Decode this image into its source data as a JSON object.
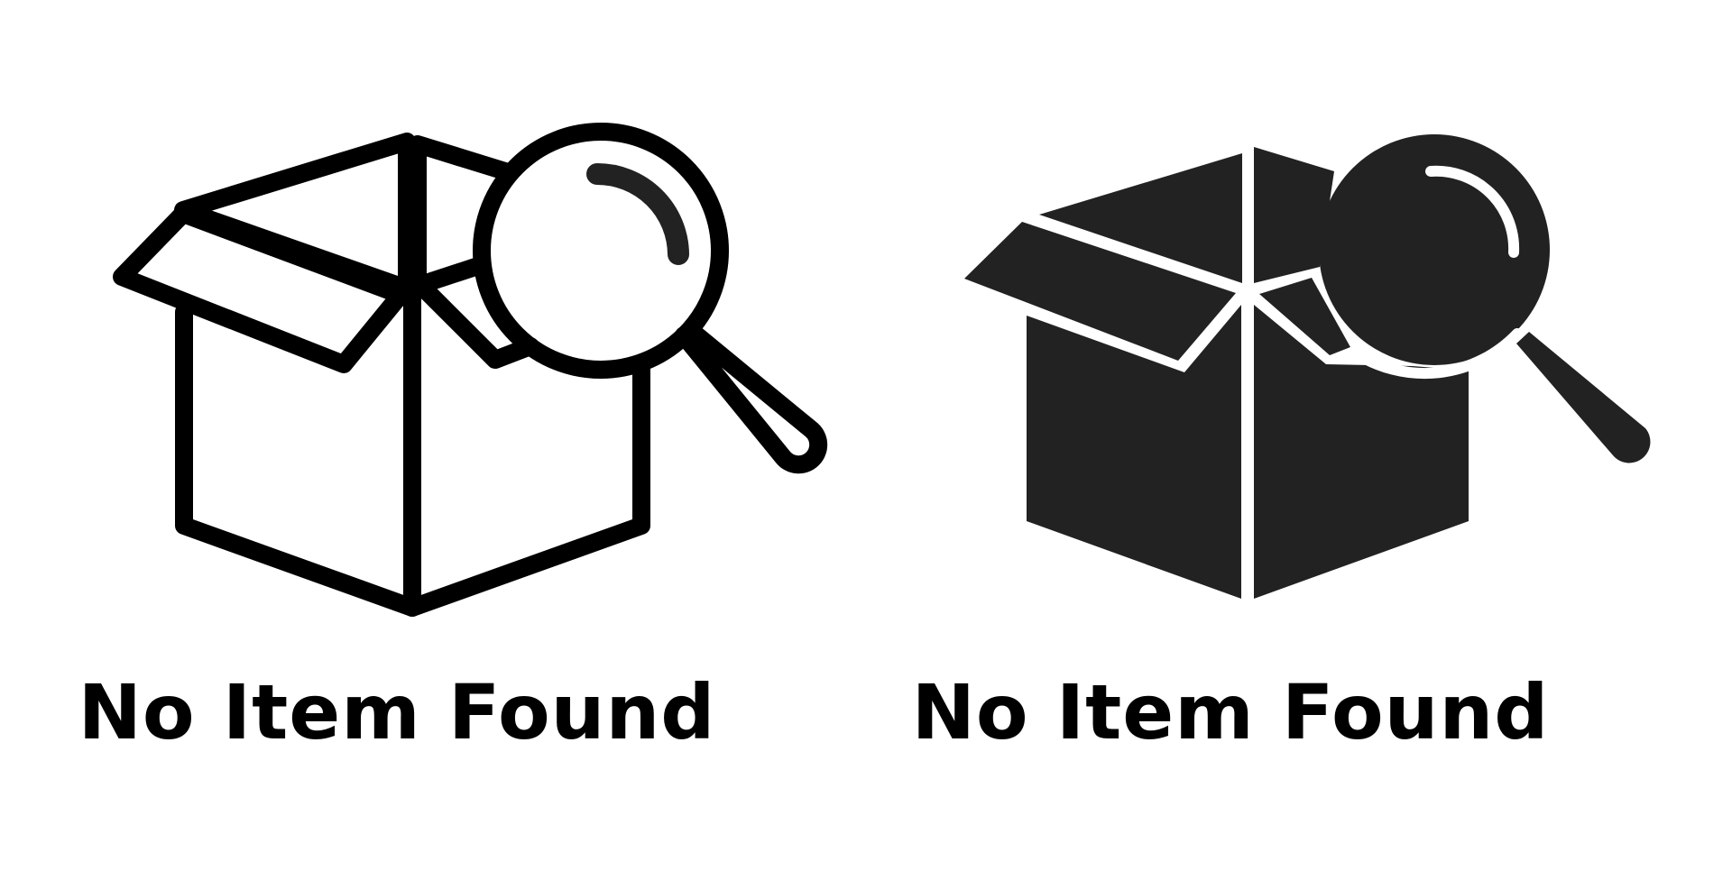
{
  "variants": [
    {
      "style": "outline",
      "icon": "open-box-magnifier-icon",
      "caption": "No Item Found",
      "color": "#000000"
    },
    {
      "style": "solid",
      "icon": "open-box-magnifier-icon",
      "caption": "No Item Found",
      "color": "#222222"
    }
  ]
}
